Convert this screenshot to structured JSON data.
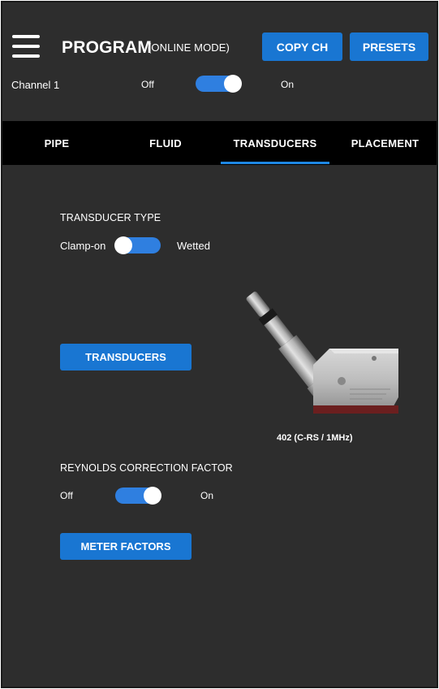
{
  "header": {
    "title": "PROGRAM",
    "subtitle": "(ONLINE MODE)",
    "copy_label": "COPY CH",
    "presets_label": "PRESETS",
    "channel_label": "Channel 1",
    "channel_off": "Off",
    "channel_on": "On",
    "channel_state": "on"
  },
  "tabs": [
    {
      "label": "PIPE"
    },
    {
      "label": "FLUID"
    },
    {
      "label": "TRANSDUCERS",
      "active": true
    },
    {
      "label": "PLACEMENT"
    }
  ],
  "transducer_type": {
    "label": "TRANSDUCER TYPE",
    "left_option": "Clamp-on",
    "right_option": "Wetted",
    "state": "off",
    "button_label": "TRANSDUCERS"
  },
  "image": {
    "caption": "402 (C-RS / 1MHz)"
  },
  "reynolds": {
    "label": "REYNOLDS CORRECTION FACTOR",
    "off_label": "Off",
    "on_label": "On",
    "state": "on",
    "button_label": "METER FACTORS"
  },
  "icons": {
    "menu": "hamburger-menu-icon"
  },
  "colors": {
    "background": "#2d2d2d",
    "tab_bar": "#000000",
    "accent": "#1976d2",
    "toggle": "#2f7fe0"
  }
}
